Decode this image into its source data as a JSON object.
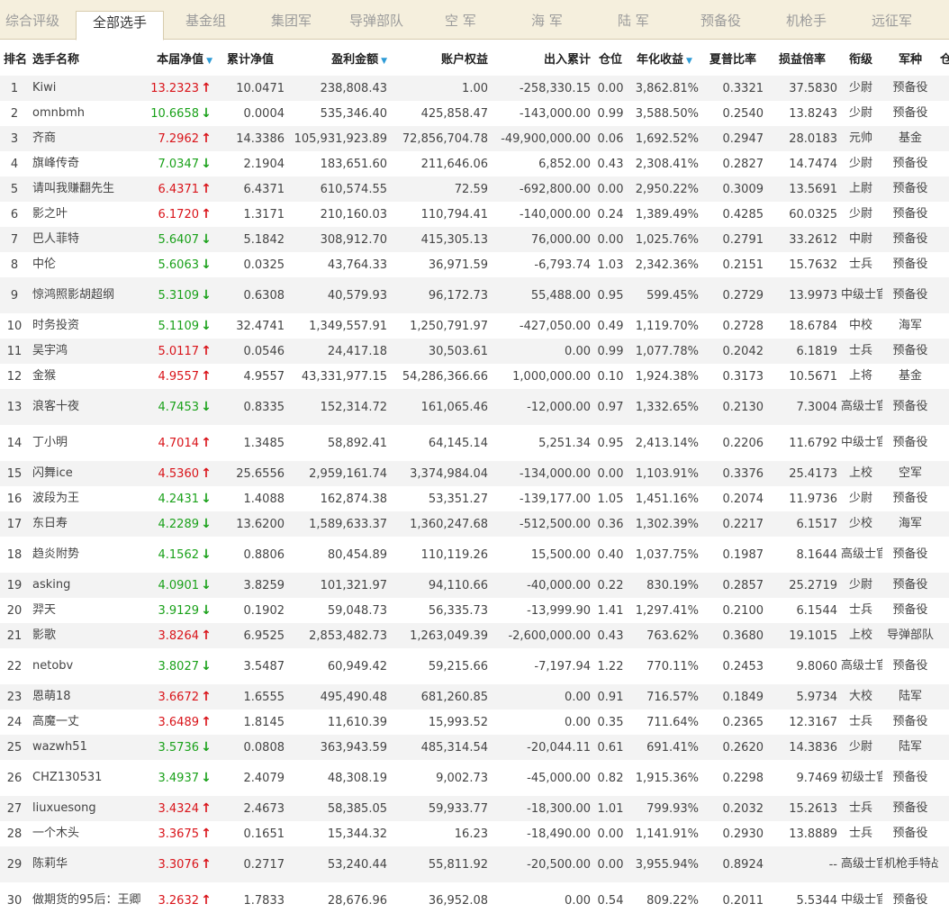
{
  "tabs": [
    {
      "label": "综合评级",
      "active": false
    },
    {
      "label": "全部选手",
      "active": true
    },
    {
      "label": "基金组",
      "active": false
    },
    {
      "label": "集团军",
      "active": false
    },
    {
      "label": "导弹部队",
      "active": false
    },
    {
      "label": "空 军",
      "active": false
    },
    {
      "label": "海 军",
      "active": false
    },
    {
      "label": "陆 军",
      "active": false
    },
    {
      "label": "预备役",
      "active": false
    },
    {
      "label": "机枪手",
      "active": false
    },
    {
      "label": "远征军",
      "active": false
    }
  ],
  "table": {
    "headers": {
      "rank": "排名",
      "name": "选手名称",
      "nav": "本届净值",
      "cum_nav": "累计净值",
      "profit": "盈利金额",
      "equity": "账户权益",
      "inout": "出入累计",
      "position": "仓位",
      "annual": "年化收益",
      "sharpe": "夏普比率",
      "pl_ratio": "损益倍率",
      "rank_title": "衔级",
      "branch": "军种",
      "overflow": "仓"
    },
    "rows": [
      {
        "rank": "1",
        "name": "Kiwi",
        "nav": "13.2323",
        "trend": "up",
        "cum": "10.0471",
        "profit": "238,808.43",
        "equity": "1.00",
        "inout": "-258,330.15",
        "pos": "0.00",
        "annual": "3,862.81%",
        "sharpe": "0.3321",
        "pl": "37.5830",
        "title": "少尉",
        "branch": "预备役"
      },
      {
        "rank": "2",
        "name": "omnbmh",
        "nav": "10.6658",
        "trend": "down",
        "cum": "0.0004",
        "profit": "535,346.40",
        "equity": "425,858.47",
        "inout": "-143,000.00",
        "pos": "0.99",
        "annual": "3,588.50%",
        "sharpe": "0.2540",
        "pl": "13.8243",
        "title": "少尉",
        "branch": "预备役"
      },
      {
        "rank": "3",
        "name": "齐商",
        "nav": "7.2962",
        "trend": "up",
        "cum": "14.3386",
        "profit": "105,931,923.89",
        "equity": "72,856,704.78",
        "inout": "-49,900,000.00",
        "pos": "0.06",
        "annual": "1,692.52%",
        "sharpe": "0.2947",
        "pl": "28.0183",
        "title": "元帅",
        "branch": "基金"
      },
      {
        "rank": "4",
        "name": "旗峰传奇",
        "nav": "7.0347",
        "trend": "down",
        "cum": "2.1904",
        "profit": "183,651.60",
        "equity": "211,646.06",
        "inout": "6,852.00",
        "pos": "0.43",
        "annual": "2,308.41%",
        "sharpe": "0.2827",
        "pl": "14.7474",
        "title": "少尉",
        "branch": "预备役"
      },
      {
        "rank": "5",
        "name": "请叫我赚翻先生",
        "nav": "6.4371",
        "trend": "up",
        "cum": "6.4371",
        "profit": "610,574.55",
        "equity": "72.59",
        "inout": "-692,800.00",
        "pos": "0.00",
        "annual": "2,950.22%",
        "sharpe": "0.3009",
        "pl": "13.5691",
        "title": "上尉",
        "branch": "预备役"
      },
      {
        "rank": "6",
        "name": "影之叶",
        "nav": "6.1720",
        "trend": "up",
        "cum": "1.3171",
        "profit": "210,160.03",
        "equity": "110,794.41",
        "inout": "-140,000.00",
        "pos": "0.24",
        "annual": "1,389.49%",
        "sharpe": "0.4285",
        "pl": "60.0325",
        "title": "少尉",
        "branch": "预备役"
      },
      {
        "rank": "7",
        "name": "巴人菲特",
        "nav": "5.6407",
        "trend": "down",
        "cum": "5.1842",
        "profit": "308,912.70",
        "equity": "415,305.13",
        "inout": "76,000.00",
        "pos": "0.00",
        "annual": "1,025.76%",
        "sharpe": "0.2791",
        "pl": "33.2612",
        "title": "中尉",
        "branch": "预备役"
      },
      {
        "rank": "8",
        "name": "中伦",
        "nav": "5.6063",
        "trend": "down",
        "cum": "0.0325",
        "profit": "43,764.33",
        "equity": "36,971.59",
        "inout": "-6,793.74",
        "pos": "1.03",
        "annual": "2,342.36%",
        "sharpe": "0.2151",
        "pl": "15.7632",
        "title": "士兵",
        "branch": "预备役"
      },
      {
        "rank": "9",
        "name": "惊鸿照影胡超纲",
        "nav": "5.3109",
        "trend": "down",
        "cum": "0.6308",
        "profit": "40,579.93",
        "equity": "96,172.73",
        "inout": "55,488.00",
        "pos": "0.95",
        "annual": "599.45%",
        "sharpe": "0.2729",
        "pl": "13.9973",
        "title": "中级士官",
        "branch": "预备役"
      },
      {
        "rank": "10",
        "name": "时务投资",
        "nav": "5.1109",
        "trend": "down",
        "cum": "32.4741",
        "profit": "1,349,557.91",
        "equity": "1,250,791.97",
        "inout": "-427,050.00",
        "pos": "0.49",
        "annual": "1,119.70%",
        "sharpe": "0.2728",
        "pl": "18.6784",
        "title": "中校",
        "branch": "海军"
      },
      {
        "rank": "11",
        "name": "吴宇鸿",
        "nav": "5.0117",
        "trend": "up",
        "cum": "0.0546",
        "profit": "24,417.18",
        "equity": "30,503.61",
        "inout": "0.00",
        "pos": "0.99",
        "annual": "1,077.78%",
        "sharpe": "0.2042",
        "pl": "6.1819",
        "title": "士兵",
        "branch": "预备役"
      },
      {
        "rank": "12",
        "name": "金猴",
        "nav": "4.9557",
        "trend": "up",
        "cum": "4.9557",
        "profit": "43,331,977.15",
        "equity": "54,286,366.66",
        "inout": "1,000,000.00",
        "pos": "0.10",
        "annual": "1,924.38%",
        "sharpe": "0.3173",
        "pl": "10.5671",
        "title": "上将",
        "branch": "基金"
      },
      {
        "rank": "13",
        "name": "浪客十夜",
        "nav": "4.7453",
        "trend": "down",
        "cum": "0.8335",
        "profit": "152,314.72",
        "equity": "161,065.46",
        "inout": "-12,000.00",
        "pos": "0.97",
        "annual": "1,332.65%",
        "sharpe": "0.2130",
        "pl": "7.3004",
        "title": "高级士官",
        "branch": "预备役"
      },
      {
        "rank": "14",
        "name": "丁小明",
        "nav": "4.7014",
        "trend": "up",
        "cum": "1.3485",
        "profit": "58,892.41",
        "equity": "64,145.14",
        "inout": "5,251.34",
        "pos": "0.95",
        "annual": "2,413.14%",
        "sharpe": "0.2206",
        "pl": "11.6792",
        "title": "中级士官",
        "branch": "预备役"
      },
      {
        "rank": "15",
        "name": "闪舞ice",
        "nav": "4.5360",
        "trend": "up",
        "cum": "25.6556",
        "profit": "2,959,161.74",
        "equity": "3,374,984.04",
        "inout": "-134,000.00",
        "pos": "0.00",
        "annual": "1,103.91%",
        "sharpe": "0.3376",
        "pl": "25.4173",
        "title": "上校",
        "branch": "空军"
      },
      {
        "rank": "16",
        "name": "波段为王",
        "nav": "4.2431",
        "trend": "down",
        "cum": "1.4088",
        "profit": "162,874.38",
        "equity": "53,351.27",
        "inout": "-139,177.00",
        "pos": "1.05",
        "annual": "1,451.16%",
        "sharpe": "0.2074",
        "pl": "11.9736",
        "title": "少尉",
        "branch": "预备役"
      },
      {
        "rank": "17",
        "name": "东日寿",
        "nav": "4.2289",
        "trend": "down",
        "cum": "13.6200",
        "profit": "1,589,633.37",
        "equity": "1,360,247.68",
        "inout": "-512,500.00",
        "pos": "0.36",
        "annual": "1,302.39%",
        "sharpe": "0.2217",
        "pl": "6.1517",
        "title": "少校",
        "branch": "海军"
      },
      {
        "rank": "18",
        "name": "趋炎附势",
        "nav": "4.1562",
        "trend": "down",
        "cum": "0.8806",
        "profit": "80,454.89",
        "equity": "110,119.26",
        "inout": "15,500.00",
        "pos": "0.40",
        "annual": "1,037.75%",
        "sharpe": "0.1987",
        "pl": "8.1644",
        "title": "高级士官",
        "branch": "预备役"
      },
      {
        "rank": "19",
        "name": "asking",
        "nav": "4.0901",
        "trend": "down",
        "cum": "3.8259",
        "profit": "101,321.97",
        "equity": "94,110.66",
        "inout": "-40,000.00",
        "pos": "0.22",
        "annual": "830.19%",
        "sharpe": "0.2857",
        "pl": "25.2719",
        "title": "少尉",
        "branch": "预备役"
      },
      {
        "rank": "20",
        "name": "羿天",
        "nav": "3.9129",
        "trend": "down",
        "cum": "0.1902",
        "profit": "59,048.73",
        "equity": "56,335.73",
        "inout": "-13,999.90",
        "pos": "1.41",
        "annual": "1,297.41%",
        "sharpe": "0.2100",
        "pl": "6.1544",
        "title": "士兵",
        "branch": "预备役"
      },
      {
        "rank": "21",
        "name": "影歌",
        "nav": "3.8264",
        "trend": "up",
        "cum": "6.9525",
        "profit": "2,853,482.73",
        "equity": "1,263,049.39",
        "inout": "-2,600,000.00",
        "pos": "0.43",
        "annual": "763.62%",
        "sharpe": "0.3680",
        "pl": "19.1015",
        "title": "上校",
        "branch": "导弹部队"
      },
      {
        "rank": "22",
        "name": "netobv",
        "nav": "3.8027",
        "trend": "down",
        "cum": "3.5487",
        "profit": "60,949.42",
        "equity": "59,215.66",
        "inout": "-7,197.94",
        "pos": "1.22",
        "annual": "770.11%",
        "sharpe": "0.2453",
        "pl": "9.8060",
        "title": "高级士官",
        "branch": "预备役"
      },
      {
        "rank": "23",
        "name": "恩萌18",
        "nav": "3.6672",
        "trend": "up",
        "cum": "1.6555",
        "profit": "495,490.48",
        "equity": "681,260.85",
        "inout": "0.00",
        "pos": "0.91",
        "annual": "716.57%",
        "sharpe": "0.1849",
        "pl": "5.9734",
        "title": "大校",
        "branch": "陆军"
      },
      {
        "rank": "24",
        "name": "高魔一丈",
        "nav": "3.6489",
        "trend": "up",
        "cum": "1.8145",
        "profit": "11,610.39",
        "equity": "15,993.52",
        "inout": "0.00",
        "pos": "0.35",
        "annual": "711.64%",
        "sharpe": "0.2365",
        "pl": "12.3167",
        "title": "士兵",
        "branch": "预备役"
      },
      {
        "rank": "25",
        "name": "wazwh51",
        "nav": "3.5736",
        "trend": "down",
        "cum": "0.0808",
        "profit": "363,943.59",
        "equity": "485,314.54",
        "inout": "-20,044.11",
        "pos": "0.61",
        "annual": "691.41%",
        "sharpe": "0.2620",
        "pl": "14.3836",
        "title": "少尉",
        "branch": "陆军"
      },
      {
        "rank": "26",
        "name": "CHZ130531",
        "nav": "3.4937",
        "trend": "down",
        "cum": "2.4079",
        "profit": "48,308.19",
        "equity": "9,002.73",
        "inout": "-45,000.00",
        "pos": "0.82",
        "annual": "1,915.36%",
        "sharpe": "0.2298",
        "pl": "9.7469",
        "title": "初级士官",
        "branch": "预备役"
      },
      {
        "rank": "27",
        "name": "liuxuesong",
        "nav": "3.4324",
        "trend": "up",
        "cum": "2.4673",
        "profit": "58,385.05",
        "equity": "59,933.77",
        "inout": "-18,300.00",
        "pos": "1.01",
        "annual": "799.93%",
        "sharpe": "0.2032",
        "pl": "15.2613",
        "title": "士兵",
        "branch": "预备役"
      },
      {
        "rank": "28",
        "name": "一个木头",
        "nav": "3.3675",
        "trend": "up",
        "cum": "0.1651",
        "profit": "15,344.32",
        "equity": "16.23",
        "inout": "-18,490.00",
        "pos": "0.00",
        "annual": "1,141.91%",
        "sharpe": "0.2930",
        "pl": "13.8889",
        "title": "士兵",
        "branch": "预备役"
      },
      {
        "rank": "29",
        "name": "陈莉华",
        "nav": "3.3076",
        "trend": "up",
        "cum": "0.2717",
        "profit": "53,240.44",
        "equity": "55,811.92",
        "inout": "-20,500.00",
        "pos": "0.00",
        "annual": "3,955.94%",
        "sharpe": "0.8924",
        "pl": "--",
        "title": "高级士官",
        "branch": "机枪手特战营"
      },
      {
        "rank": "30",
        "name": "做期货的95后：王卿",
        "nav": "3.2632",
        "trend": "up",
        "cum": "1.7833",
        "profit": "28,676.96",
        "equity": "36,952.08",
        "inout": "0.00",
        "pos": "0.54",
        "annual": "809.22%",
        "sharpe": "0.2011",
        "pl": "5.5344",
        "title": "中级士官",
        "branch": "预备役"
      }
    ]
  },
  "colors": {
    "up": "#d9141a",
    "down": "#1aa11a",
    "sort": "#2d9bd6",
    "tabbar": "#f5efdd"
  },
  "icons": {
    "up": "arrow-up-icon",
    "down": "arrow-down-icon",
    "sort": "sort-desc-icon"
  }
}
